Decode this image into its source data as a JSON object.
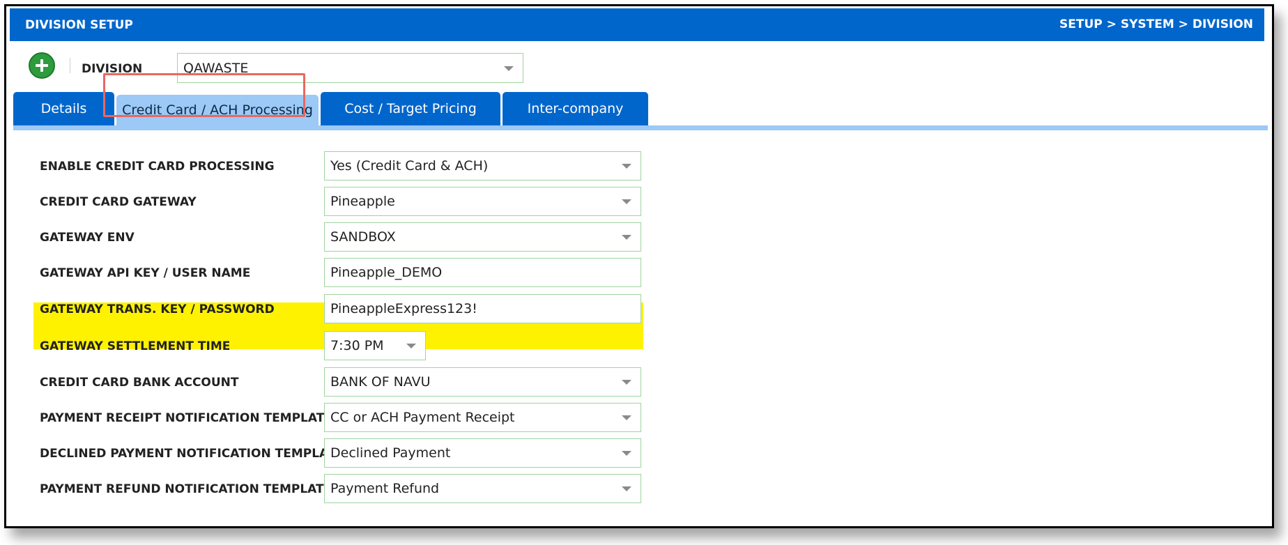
{
  "header": {
    "title": "DIVISION SETUP",
    "breadcrumb": "SETUP > SYSTEM > DIVISION"
  },
  "division": {
    "label": "DIVISION",
    "value": "QAWASTE",
    "add_icon": "plus-circle-icon"
  },
  "tabs": [
    {
      "label": "Details",
      "active": false
    },
    {
      "label": "Credit Card / ACH Processing",
      "active": true
    },
    {
      "label": "Cost / Target Pricing",
      "active": false
    },
    {
      "label": "Inter-company",
      "active": false
    }
  ],
  "fields": [
    {
      "label": "ENABLE CREDIT CARD PROCESSING",
      "type": "select",
      "value": "Yes (Credit Card & ACH)"
    },
    {
      "label": "CREDIT CARD GATEWAY",
      "type": "select",
      "value": "Pineapple"
    },
    {
      "label": "GATEWAY ENV",
      "type": "select",
      "value": "SANDBOX"
    },
    {
      "label": "GATEWAY API KEY / USER NAME",
      "type": "text",
      "value": "Pineapple_DEMO"
    },
    {
      "label": "GATEWAY TRANS. KEY / PASSWORD",
      "type": "text",
      "value": "PineappleExpress123!"
    },
    {
      "label": "GATEWAY SETTLEMENT TIME",
      "type": "select",
      "value": "7:30 PM"
    },
    {
      "label": "CREDIT CARD BANK ACCOUNT",
      "type": "select",
      "value": "BANK OF NAVU",
      "highlighted": true
    },
    {
      "label": "PAYMENT RECEIPT NOTIFICATION TEMPLATE",
      "type": "select",
      "value": "CC or ACH Payment Receipt"
    },
    {
      "label": "DECLINED PAYMENT NOTIFICATION TEMPLATE",
      "type": "select",
      "value": "Declined Payment"
    },
    {
      "label": "PAYMENT REFUND NOTIFICATION TEMPLATE",
      "type": "select",
      "value": "Payment Refund"
    }
  ],
  "colors": {
    "header_bg": "#0066cc",
    "tab_active_bg": "#9cc9f5",
    "highlight": "#fff200",
    "tab_outline": "#e8685f",
    "add_button": "#2e9b3e"
  }
}
